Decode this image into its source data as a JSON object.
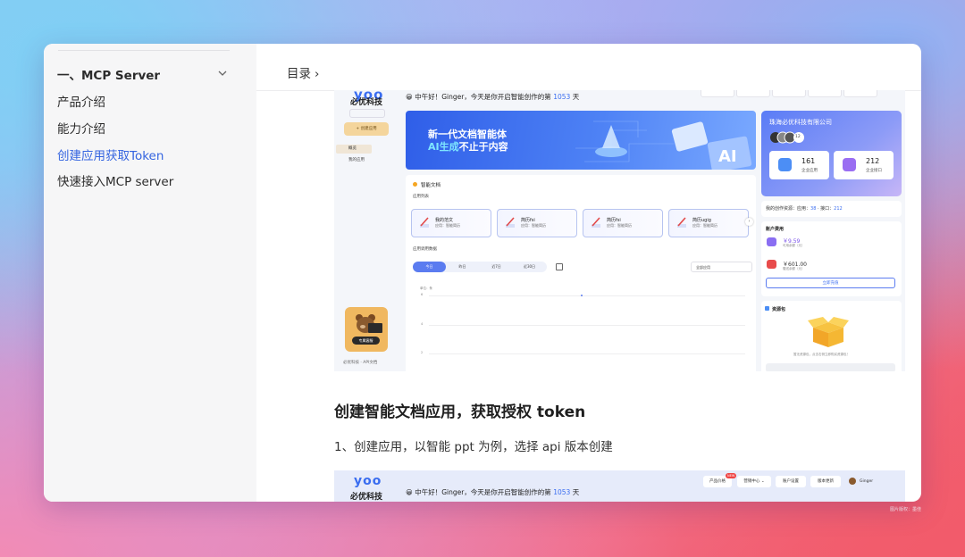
{
  "sidebar": {
    "section_title": "一、MCP Server",
    "items": [
      {
        "label": "产品介绍"
      },
      {
        "label": "能力介绍"
      },
      {
        "label": "创建应用获取Token"
      },
      {
        "label": "快速接入MCP server"
      }
    ]
  },
  "header": {
    "toc_label": "目录",
    "toc_arrow": "›"
  },
  "article": {
    "heading": "创建智能文档应用，获取授权 token",
    "step1": "1、创建应用，以智能 ppt 为例，选择 api 版本创建"
  },
  "screenshot1": {
    "logo": "yoo",
    "logo_sub": "必优科技",
    "create_button": "+ 创建应用",
    "nav_overview": "概览",
    "nav_myapps": "我的应用",
    "bear_button": "专属客服",
    "footer_links": "必优科技 · API文档",
    "greeting_prefix": "😀 中午好！Ginger，今天是你开启智能创作的第",
    "greeting_days": "1053",
    "greeting_suffix": "天",
    "banner_line1": "新一代文档智能体",
    "banner_line2_highlight": "AI生成",
    "banner_line2_rest": "不止于内容",
    "company_name": "珠海必优科技有限公司",
    "company_members": "12",
    "enterprise_apps_count": "161",
    "enterprise_apps_label": "企业应用",
    "enterprise_api_count": "212",
    "enterprise_api_label": "企业接口",
    "quota_prefix": "我的创作资源：应用：",
    "quota_apps": "38",
    "quota_mid": "· 接口：",
    "quota_api": "212",
    "account_title": "账户费用",
    "balance1": "￥9.59",
    "balance1_label": "可用余额（元）",
    "balance2": "￥601.00",
    "balance2_label": "赠送余额（元）",
    "recharge_button": "立即充值",
    "resource_pack_title": "资源包",
    "resource_pack_empty": "暂无资源包，点击右侧立即购买资源包！",
    "docs_title": "智能文档",
    "app_list_label": "应用列表",
    "apps": [
      {
        "name": "我的范文",
        "type": "应用：智能简历"
      },
      {
        "name": "简历fsi",
        "type": "应用：智能简历"
      },
      {
        "name": "简历fsi",
        "type": "应用：智能简历"
      },
      {
        "name": "简历ugig",
        "type": "应用：智能简历"
      }
    ],
    "usage_label": "应用调用数据",
    "tabs": [
      "今日",
      "昨日",
      "近7日",
      "近30日"
    ],
    "app_select": "全部应用",
    "y_unit": "单位：条",
    "y_ticks": [
      "6",
      "4",
      "2"
    ]
  },
  "screenshot2": {
    "logo": "yoo",
    "logo_sub": "必优科技",
    "greeting_prefix": "😀 中午好！Ginger，今天是你开启智能创作的第",
    "greeting_days": "1053",
    "greeting_suffix": "天",
    "nav_buttons": [
      "产品价格",
      "营销中心 ⌄",
      "账户设置",
      "版本更新"
    ],
    "badge": "NEW",
    "user": "Ginger"
  },
  "credit": "图片版权：墨佳",
  "colors": {
    "accent": "#3464e0",
    "brand": "#3a6df0",
    "banner": "#2f5ee8"
  }
}
